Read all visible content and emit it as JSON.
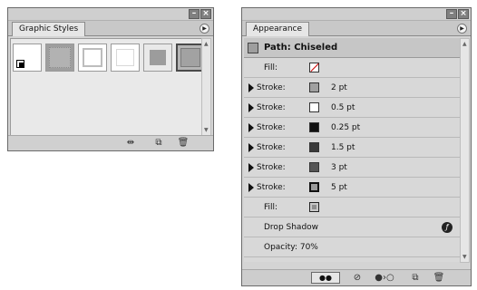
{
  "graphic_styles": {
    "tab_label": "Graphic Styles",
    "swatches": [
      "default",
      "texture",
      "border",
      "outline",
      "gray",
      "selected"
    ]
  },
  "appearance": {
    "tab_label": "Appearance",
    "header_title": "Path: Chiseled",
    "rows": [
      {
        "label": "Fill:",
        "value": ""
      },
      {
        "label": "Stroke:",
        "value": "2 pt"
      },
      {
        "label": "Stroke:",
        "value": "0.5 pt"
      },
      {
        "label": "Stroke:",
        "value": "0.25 pt"
      },
      {
        "label": "Stroke:",
        "value": "1.5 pt"
      },
      {
        "label": "Stroke:",
        "value": "3 pt"
      },
      {
        "label": "Stroke:",
        "value": "5 pt"
      },
      {
        "label": "Fill:",
        "value": ""
      },
      {
        "label": "Drop Shadow",
        "value": ""
      },
      {
        "label": "Opacity: 70%",
        "value": ""
      }
    ]
  },
  "colors": {
    "panel_bg": "#d4d4d4",
    "swatch_gray": "#a0a0a0",
    "swatch_dark": "#111111"
  }
}
